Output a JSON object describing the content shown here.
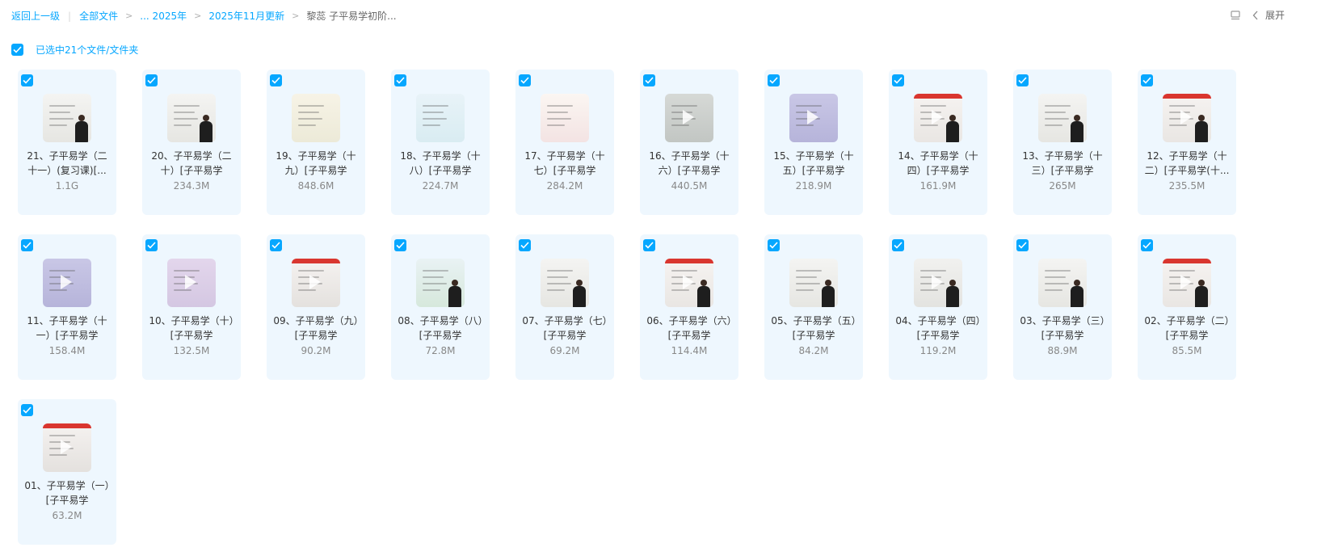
{
  "breadcrumb": {
    "back": "返回上一级",
    "all_files": "全部文件",
    "ellipsis_year": "... 2025年",
    "month": "2025年11月更新",
    "current": "黎蕊 子平易学初阶..."
  },
  "toolbar": {
    "expand": "展开"
  },
  "selection": {
    "label": "已选中21个文件/文件夹"
  },
  "colors": {
    "accent": "#06a7ff",
    "card_bg": "#eef7fe"
  },
  "files": [
    {
      "name": "21、子平易学（二十一）(复习课)[...",
      "size": "1.1G",
      "thumb": "person-board"
    },
    {
      "name": "20、子平易学（二十）[子平易学",
      "size": "234.3M",
      "thumb": "person-board"
    },
    {
      "name": "19、子平易学（十九）[子平易学",
      "size": "848.6M",
      "thumb": "title-slide"
    },
    {
      "name": "18、子平易学（十八）[子平易学",
      "size": "224.7M",
      "thumb": "light-slide"
    },
    {
      "name": "17、子平易学（十七）[子平易学",
      "size": "284.2M",
      "thumb": "diagram-slide"
    },
    {
      "name": "16、子平易学（十六）[子平易学",
      "size": "440.5M",
      "thumb": "gray-slide"
    },
    {
      "name": "15、子平易学（十五）[子平易学",
      "size": "218.9M",
      "thumb": "purple-slide"
    },
    {
      "name": "14、子平易学（十四）[子平易学",
      "size": "161.9M",
      "thumb": "red-person"
    },
    {
      "name": "13、子平易学（十三）[子平易学",
      "size": "265M",
      "thumb": "person-board"
    },
    {
      "name": "12、子平易学（十二）[子平易学(十...",
      "size": "235.5M",
      "thumb": "red-person"
    },
    {
      "name": "11、子平易学（十一）[子平易学",
      "size": "158.4M",
      "thumb": "purple-slide"
    },
    {
      "name": "10、子平易学（十）[子平易学",
      "size": "132.5M",
      "thumb": "pink-slide"
    },
    {
      "name": "09、子平易学（九）[子平易学",
      "size": "90.2M",
      "thumb": "red-table"
    },
    {
      "name": "08、子平易学（八）[子平易学",
      "size": "72.8M",
      "thumb": "tree-person"
    },
    {
      "name": "07、子平易学（七）[子平易学",
      "size": "69.2M",
      "thumb": "person-board"
    },
    {
      "name": "06、子平易学（六）[子平易学",
      "size": "114.4M",
      "thumb": "red-person"
    },
    {
      "name": "05、子平易学（五）[子平易学",
      "size": "84.2M",
      "thumb": "person-board"
    },
    {
      "name": "04、子平易学（四）[子平易学",
      "size": "119.2M",
      "thumb": "wheel-slide"
    },
    {
      "name": "03、子平易学（三）[子平易学",
      "size": "88.9M",
      "thumb": "person-board"
    },
    {
      "name": "02、子平易学（二）[子平易学",
      "size": "85.5M",
      "thumb": "red-person"
    },
    {
      "name": "01、子平易学（一）[子平易学",
      "size": "63.2M",
      "thumb": "red-table"
    }
  ]
}
